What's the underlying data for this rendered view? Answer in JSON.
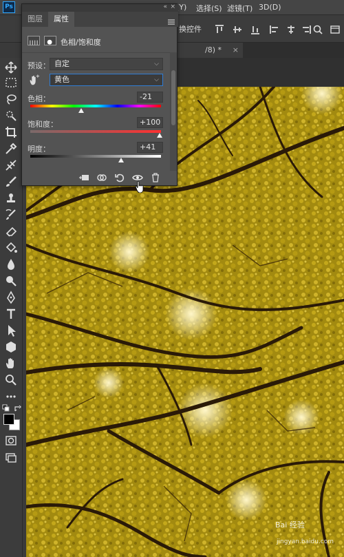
{
  "app": {
    "logo": "Ps",
    "menu": [
      "(Y)",
      "选择(S)",
      "滤镜(T)",
      "3D(D)"
    ],
    "options_label": "换控件",
    "doc_tab": "/8) *",
    "doc_tab_close": "×"
  },
  "panel": {
    "tabs": [
      "图层",
      "属性"
    ],
    "active_tab": "属性",
    "collapse": "«",
    "close": "×",
    "adjustment_title": "色相/饱和度",
    "preset_label": "预设：",
    "preset_value": "自定",
    "channel_value": "黄色",
    "hue_label": "色相：",
    "hue_value": "-21",
    "saturation_label": "饱和度：",
    "saturation_value": "+100",
    "lightness_label": "明度：",
    "lightness_value": "+41"
  },
  "watermark": {
    "brand": "Bai 经验",
    "url": "jingyan.baidu.com"
  },
  "colors": {
    "accent": "#2f7dd6",
    "foreground": "#000000",
    "background": "#ffffff"
  }
}
